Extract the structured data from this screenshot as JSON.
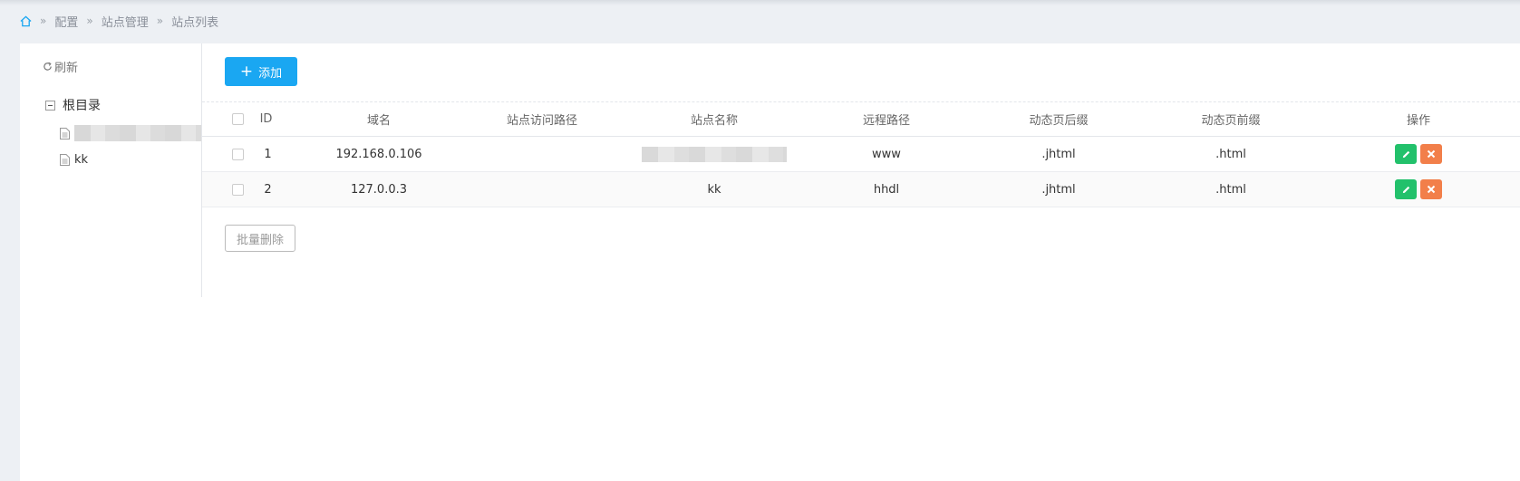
{
  "breadcrumb": {
    "items": [
      "配置",
      "站点管理",
      "站点列表"
    ],
    "separator": "»"
  },
  "sidebar": {
    "refresh_label": "刷新",
    "root_label": "根目录",
    "children": [
      {
        "label": "",
        "redacted": true
      },
      {
        "label": "kk"
      }
    ]
  },
  "toolbar": {
    "add_label": "添加"
  },
  "table": {
    "columns": [
      "ID",
      "域名",
      "站点访问路径",
      "站点名称",
      "远程路径",
      "动态页后缀",
      "动态页前缀",
      "操作"
    ],
    "rows": [
      {
        "id": "1",
        "domain": "192.168.0.106",
        "path": "",
        "name": "",
        "name_redacted": true,
        "remote": "www",
        "suffix": ".jhtml",
        "prefix": ".html"
      },
      {
        "id": "2",
        "domain": "127.0.0.3",
        "path": "",
        "name": "kk",
        "remote": "hhdl",
        "suffix": ".jhtml",
        "prefix": ".html"
      }
    ]
  },
  "batch_delete_label": "批量删除",
  "colors": {
    "primary": "#1aa7f2",
    "edit": "#22c16b",
    "delete": "#f27f4a",
    "background": "#edf0f4"
  },
  "icons": {
    "home": "home-icon",
    "refresh": "refresh-icon",
    "edit": "pencil-icon",
    "delete": "close-icon",
    "tree_leaf": "document-icon"
  }
}
